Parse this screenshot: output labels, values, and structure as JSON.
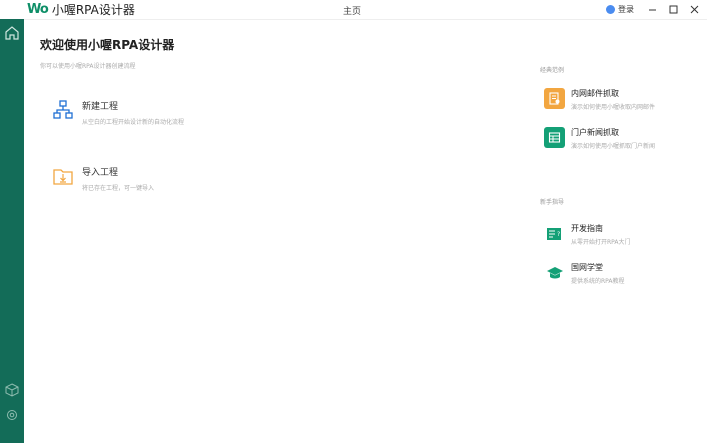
{
  "app": {
    "logo_mark": "Wo",
    "name": "小喔RPA设计器",
    "window_title": "主页",
    "login_label": "登录"
  },
  "colors": {
    "sidebar": "#136c58",
    "brand_green": "#0f8f68",
    "orange": "#f2a640",
    "icon_blue": "#1f6fd4"
  },
  "main": {
    "heading": "欢迎使用小喔RPA设计器",
    "subheading": "你可以使用小喔RPA设计器创建流程",
    "actions": [
      {
        "title": "新建工程",
        "desc": "从空白的工程开始设计新的自动化流程",
        "icon": "network-icon"
      },
      {
        "title": "导入工程",
        "desc": "将已存在工程，可一键导入",
        "icon": "import-folder-icon"
      }
    ]
  },
  "examples": {
    "label": "经典范例",
    "items": [
      {
        "title": "内网邮件抓取",
        "desc": "演示如何使用小喔收取内网邮件",
        "icon": "mail-document-icon",
        "color": "#f2a640"
      },
      {
        "title": "门户新闻抓取",
        "desc": "演示如何使用小喔抓取门户新闻",
        "icon": "table-icon",
        "color": "#14a076"
      }
    ]
  },
  "guides": {
    "label": "新手指导",
    "items": [
      {
        "title": "开发指南",
        "desc": "从零开始打开RPA大门",
        "icon": "book-icon"
      },
      {
        "title": "国网学堂",
        "desc": "提供系统的RPA教程",
        "icon": "graduation-cap-icon"
      }
    ]
  }
}
